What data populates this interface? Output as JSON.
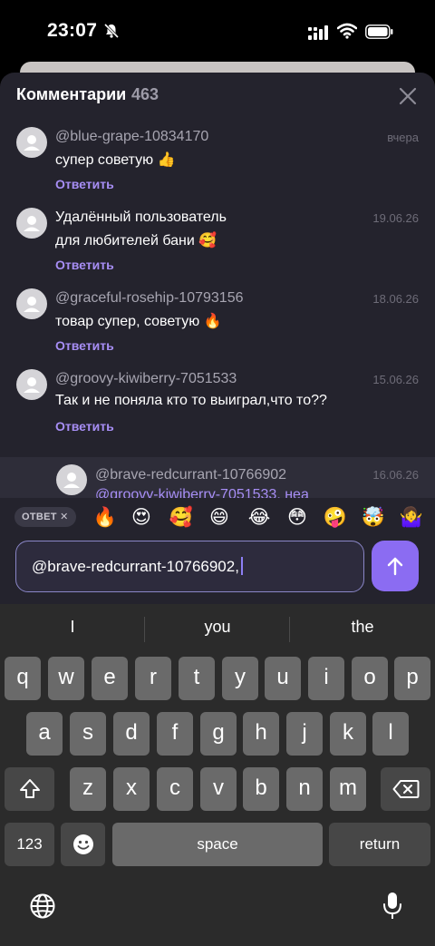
{
  "status_bar": {
    "time": "23:07"
  },
  "panel": {
    "title": "Комментарии",
    "count": "463",
    "comments": [
      {
        "author": "@blue-grape-10834170",
        "text": "супер советую 👍",
        "date": "вчера",
        "reply": "Ответить"
      },
      {
        "author": "Удалённый пользователь",
        "text": "для любителей бани 🥰",
        "date": "19.06.26",
        "reply": "Ответить"
      },
      {
        "author": "@graceful-rosehip-10793156",
        "text": "товар супер, советую 🔥",
        "date": "18.06.26",
        "reply": "Ответить"
      },
      {
        "author": "@groovy-kiwiberry-7051533",
        "text": "Так и не поняла кто то выиграл,что то??",
        "date": "15.06.26",
        "reply": "Ответить"
      }
    ],
    "reply_item": {
      "author": "@brave-redcurrant-10766902",
      "text": "@groovy-kiwiberry-7051533, неа",
      "date": "16.06.26"
    }
  },
  "composer": {
    "reply_chip": "ОТВЕТ ✕",
    "emojis": [
      "🔥",
      "😍",
      "🥰",
      "😄",
      "😂",
      "😳",
      "🤪",
      "🤯",
      "🤷‍♀️"
    ],
    "input_value": "@brave-redcurrant-10766902,"
  },
  "keyboard": {
    "suggestions": [
      "I",
      "you",
      "the"
    ],
    "row1": [
      "q",
      "w",
      "e",
      "r",
      "t",
      "y",
      "u",
      "i",
      "o",
      "p"
    ],
    "row2": [
      "a",
      "s",
      "d",
      "f",
      "g",
      "h",
      "j",
      "k",
      "l"
    ],
    "row3": [
      "z",
      "x",
      "c",
      "v",
      "b",
      "n",
      "m"
    ],
    "numbers_label": "123",
    "space_label": "space",
    "return_label": "return"
  },
  "colors": {
    "accent": "#8b6cf2",
    "panel_bg": "#24232d",
    "reply_link": "#a78ef5"
  },
  "icons": [
    "bell-off-icon",
    "signal-icon",
    "wifi-icon",
    "battery-icon",
    "close-icon",
    "avatar-icon",
    "send-arrow-icon",
    "shift-icon",
    "backspace-icon",
    "emoji-icon",
    "globe-icon",
    "microphone-icon"
  ]
}
